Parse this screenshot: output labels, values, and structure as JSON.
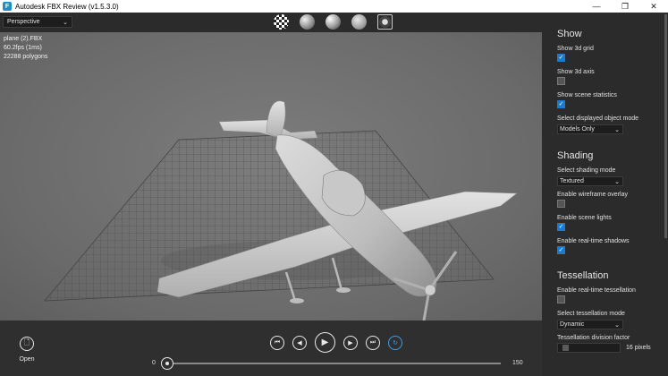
{
  "window": {
    "title": "Autodesk FBX Review (v1.5.3.0)",
    "app_icon": "F",
    "minimize": "—",
    "maximize": "❐",
    "close": "✕"
  },
  "toolbar": {
    "view_mode": "Perspective",
    "shading_icons": [
      "checker-sphere-icon",
      "plain-sphere-icon",
      "lit-sphere-icon",
      "soft-sphere-icon",
      "frame-icon"
    ]
  },
  "viewport": {
    "file_name": "plane (2).FBX",
    "fps": "60.2fps (1ms)",
    "polygons": "22288 polygons"
  },
  "bottom": {
    "open_label": "Open",
    "timeline_start": "0",
    "timeline_end": "150"
  },
  "panel": {
    "show": {
      "title": "Show",
      "grid_label": "Show 3d grid",
      "axis_label": "Show 3d axis",
      "stats_label": "Show scene statistics",
      "object_mode_label": "Select displayed object mode",
      "object_mode_value": "Models Only"
    },
    "shading": {
      "title": "Shading",
      "mode_label": "Select shading mode",
      "mode_value": "Textured",
      "wireframe_label": "Enable wireframe overlay",
      "lights_label": "Enable scene lights",
      "shadows_label": "Enable real-time shadows"
    },
    "tessellation": {
      "title": "Tessellation",
      "realtime_label": "Enable real-time tessellation",
      "mode_label": "Select tessellation mode",
      "mode_value": "Dynamic",
      "factor_label": "Tessellation division factor",
      "factor_value": "16 pixels"
    }
  },
  "colors": {
    "accent": "#1a7bd0",
    "loop": "#3a9ee8"
  }
}
